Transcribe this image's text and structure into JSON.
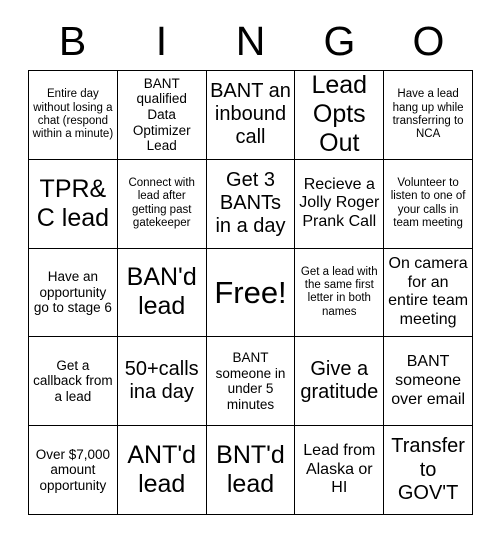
{
  "card": {
    "title": "BINGO",
    "header_letters": [
      "B",
      "I",
      "N",
      "G",
      "O"
    ],
    "colors": {
      "background": "#ffffff",
      "text": "#000000",
      "grid_line": "#000000"
    },
    "grid": {
      "rows": 5,
      "columns": 5,
      "free_space_index": 12
    },
    "cells": [
      {
        "text": "Entire day without losing a chat (respond within a minute)",
        "size": "xs"
      },
      {
        "text": "BANT qualified Data Optimizer Lead",
        "size": "s"
      },
      {
        "text": "BANT an inbound call",
        "size": "l"
      },
      {
        "text": "Lead Opts Out",
        "size": "xl"
      },
      {
        "text": "Have a lead hang up while transferring to NCA",
        "size": "xs"
      },
      {
        "text": "TPR&C lead",
        "size": "xl"
      },
      {
        "text": "Connect with lead after getting past gatekeeper",
        "size": "xs"
      },
      {
        "text": "Get 3 BANTs in a day",
        "size": "l"
      },
      {
        "text": "Recieve a Jolly Roger Prank Call",
        "size": "m"
      },
      {
        "text": "Volunteer to listen to one of your calls in team meeting",
        "size": "xs"
      },
      {
        "text": "Have an opportunity go to stage 6",
        "size": "s"
      },
      {
        "text": "BAN'd lead",
        "size": "xl"
      },
      {
        "text": "Free!",
        "size": "free"
      },
      {
        "text": "Get a lead with the same first letter in both names",
        "size": "xs"
      },
      {
        "text": "On camera for an entire team meeting",
        "size": "m"
      },
      {
        "text": "Get a callback from a lead",
        "size": "s"
      },
      {
        "text": "50+calls ina day",
        "size": "l"
      },
      {
        "text": "BANT someone in under 5 minutes",
        "size": "s"
      },
      {
        "text": "Give a gratitude",
        "size": "l"
      },
      {
        "text": "BANT someone over email",
        "size": "m"
      },
      {
        "text": "Over $7,000 amount opportunity",
        "size": "s"
      },
      {
        "text": "ANT'd lead",
        "size": "xl"
      },
      {
        "text": "BNT'd lead",
        "size": "xl"
      },
      {
        "text": "Lead from Alaska or HI",
        "size": "m"
      },
      {
        "text": "Transfer to GOV'T",
        "size": "l"
      }
    ]
  }
}
